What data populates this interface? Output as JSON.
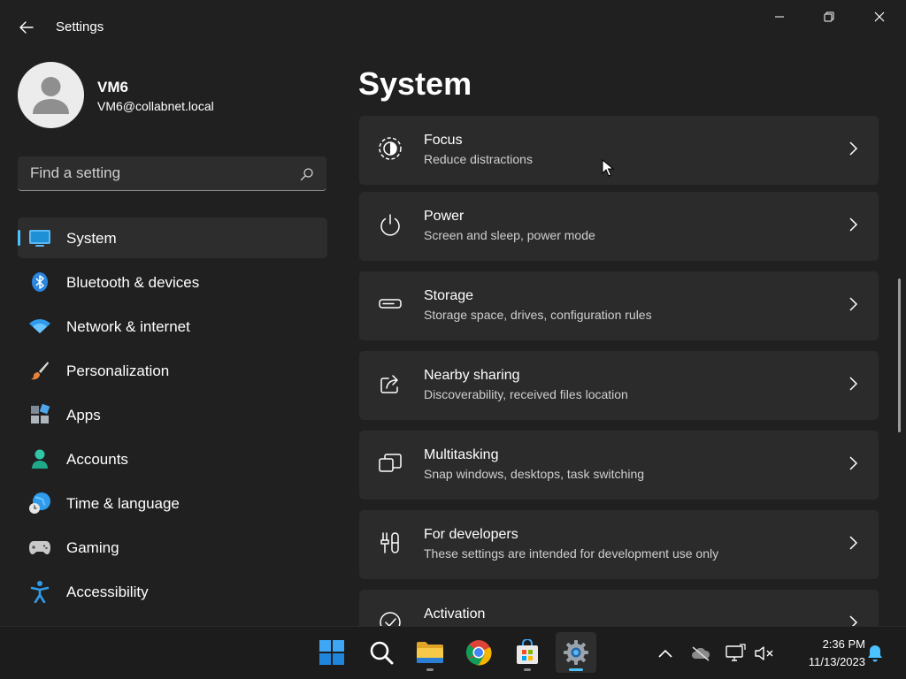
{
  "window": {
    "title": "Settings",
    "back_icon": "back-arrow-icon",
    "controls": [
      "minimize-icon",
      "restore-icon",
      "close-icon"
    ]
  },
  "profile": {
    "name": "VM6",
    "email": "VM6@collabnet.local"
  },
  "search": {
    "placeholder": "Find a setting",
    "value": ""
  },
  "sidebar": {
    "items": [
      {
        "label": "System",
        "icon": "system-icon",
        "active": true
      },
      {
        "label": "Bluetooth & devices",
        "icon": "bluetooth-icon"
      },
      {
        "label": "Network & internet",
        "icon": "wifi-icon"
      },
      {
        "label": "Personalization",
        "icon": "paintbrush-icon"
      },
      {
        "label": "Apps",
        "icon": "apps-icon"
      },
      {
        "label": "Accounts",
        "icon": "accounts-icon"
      },
      {
        "label": "Time & language",
        "icon": "time-language-icon"
      },
      {
        "label": "Gaming",
        "icon": "gamepad-icon"
      },
      {
        "label": "Accessibility",
        "icon": "accessibility-icon"
      }
    ]
  },
  "main": {
    "title": "System",
    "cards": [
      {
        "title": "Focus",
        "subtitle": "Reduce distractions",
        "icon": "focus-icon"
      },
      {
        "title": "Power",
        "subtitle": "Screen and sleep, power mode",
        "icon": "power-icon"
      },
      {
        "title": "Storage",
        "subtitle": "Storage space, drives, configuration rules",
        "icon": "storage-icon"
      },
      {
        "title": "Nearby sharing",
        "subtitle": "Discoverability, received files location",
        "icon": "share-icon"
      },
      {
        "title": "Multitasking",
        "subtitle": "Snap windows, desktops, task switching",
        "icon": "multitasking-icon"
      },
      {
        "title": "For developers",
        "subtitle": "These settings are intended for development use only",
        "icon": "developer-tools-icon"
      },
      {
        "title": "Activation",
        "subtitle": "",
        "icon": "activation-icon"
      }
    ]
  },
  "taskbar": {
    "apps": [
      {
        "name": "start",
        "icon": "windows-start-icon"
      },
      {
        "name": "search",
        "icon": "search-icon"
      },
      {
        "name": "file-explorer",
        "icon": "folder-icon"
      },
      {
        "name": "chrome",
        "icon": "chrome-icon"
      },
      {
        "name": "store",
        "icon": "store-icon"
      },
      {
        "name": "settings",
        "icon": "gear-icon",
        "active": true
      }
    ],
    "tray": [
      "chevron-up-icon",
      "onedrive-offline-icon",
      "network-icon",
      "speaker-muted-icon"
    ],
    "clock": {
      "time": "2:36 PM",
      "date": "11/13/2023"
    },
    "notification_icon": "bell-icon"
  },
  "colors": {
    "background": "#202020",
    "card": "#2b2b2b",
    "accent": "#4cc2ff",
    "taskbar": "#1c1c1c"
  }
}
